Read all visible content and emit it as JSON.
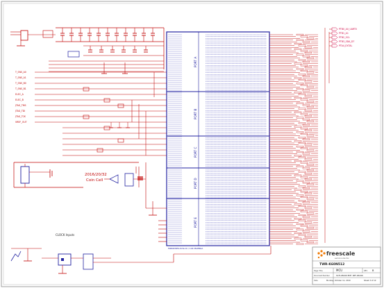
{
  "colors": {
    "wire": "#c00000",
    "ic": "#2020a0",
    "text": "#c00000",
    "border": "#a0a0a0",
    "netlabel": "#d00040",
    "logo": "#f07800"
  },
  "mcu": {
    "ports": [
      "PORT A",
      "PORT B",
      "PORT C",
      "PORT D",
      "PORT E"
    ],
    "footer": "MK60DN512VLL10 / 144 MAPBGA"
  },
  "coin_cell": {
    "line1": "2016/20/32",
    "line2": "Coin Cell"
  },
  "clock": {
    "label": "CLOCK Inputs"
  },
  "left_labels": [
    "T_SNS_A0",
    "T_SNS_A1",
    "T_SNS_B0",
    "T_SNS_B1",
    "ELEC_A",
    "ELEC_B",
    "JTAG_TMS",
    "JTAG_TDI",
    "JTAG_TCK",
    "VREF_OUT"
  ],
  "right_nets": [
    "PTB0_A0_UART0",
    "PTB1_A1",
    "PTB2_SCL",
    "PTB3_SDA_D7",
    "PTA4_EXTAL"
  ],
  "title_block": {
    "logo": "freescale",
    "logo_sub": "semiconductor",
    "title_label": "TWR-K60N512",
    "title": "TWR-K60N512",
    "subtitle": "K60N512 MCU",
    "sheet_label": "Page Title",
    "sheet": "MCU",
    "size_label": "Size",
    "rev_label": "REV",
    "rev": "B",
    "doc_label": "Document Number",
    "doc": "SCH-26440 PDF: SPF-26440",
    "date_label": "Date",
    "date": "Monday, October 11, 2010",
    "sheet_of": "Sheet 3 of 10"
  }
}
